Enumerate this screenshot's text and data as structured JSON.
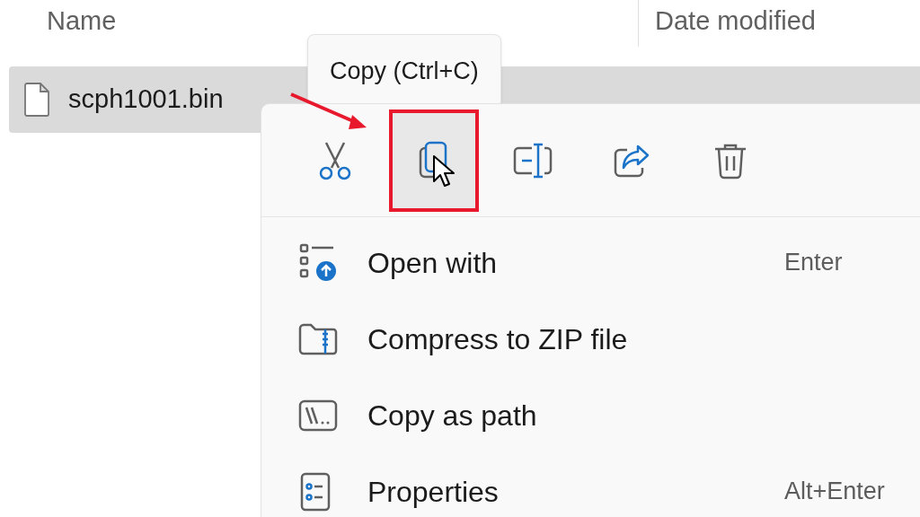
{
  "columns": [
    {
      "label": "Name"
    },
    {
      "label": "Date modified"
    }
  ],
  "file": {
    "name": "scph1001.bin",
    "selected": true
  },
  "tooltip": {
    "text": "Copy (Ctrl+C)"
  },
  "toolbar": [
    {
      "kind": "cut",
      "highlighted": false
    },
    {
      "kind": "copy",
      "highlighted": true
    },
    {
      "kind": "rename",
      "highlighted": false
    },
    {
      "kind": "share",
      "highlighted": false
    },
    {
      "kind": "delete",
      "highlighted": false
    }
  ],
  "menu_items": [
    {
      "kind": "open-with",
      "label": "Open with",
      "shortcut": "Enter"
    },
    {
      "kind": "zip",
      "label": "Compress to ZIP file"
    },
    {
      "kind": "path",
      "label": "Copy as path"
    },
    {
      "kind": "properties",
      "label": "Properties",
      "shortcut": "Alt+Enter"
    }
  ]
}
